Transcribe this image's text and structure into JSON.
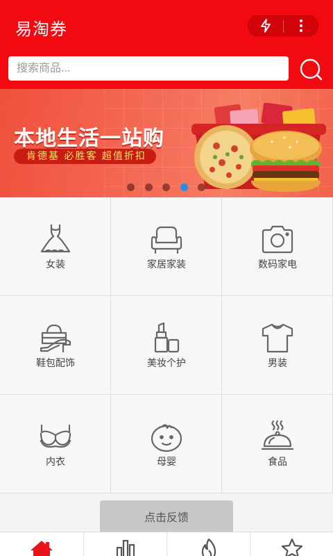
{
  "header": {
    "title": "易淘券",
    "background_color": "#f30a10",
    "capsule_icons": [
      "flash-icon",
      "more-vertical-icon"
    ]
  },
  "search": {
    "placeholder": "搜索商品...",
    "value": "",
    "icon": "search-icon"
  },
  "banner": {
    "title": "本地生活一站购",
    "tagline": "肯德基  必胜客  超值折扣",
    "slide_count": 5,
    "active_slide": 4,
    "indicator_active_color": "#2a8ce8"
  },
  "categories": [
    {
      "label": "女装",
      "icon": "dress-icon"
    },
    {
      "label": "家居家装",
      "icon": "sofa-icon"
    },
    {
      "label": "数码家电",
      "icon": "camera-icon"
    },
    {
      "label": "鞋包配饰",
      "icon": "shoe-bag-icon"
    },
    {
      "label": "美妆个护",
      "icon": "lipstick-icon"
    },
    {
      "label": "男装",
      "icon": "tshirt-icon"
    },
    {
      "label": "内衣",
      "icon": "bra-icon"
    },
    {
      "label": "母婴",
      "icon": "baby-icon"
    },
    {
      "label": "食品",
      "icon": "food-cloche-icon"
    }
  ],
  "feedback": {
    "label": "点击反馈"
  },
  "tabbar": {
    "active_color": "#e8141b",
    "inactive_color": "#555555",
    "tabs": [
      {
        "icon": "home-icon",
        "active": true
      },
      {
        "icon": "ranking-icon",
        "active": false
      },
      {
        "icon": "hot-icon",
        "active": false
      },
      {
        "icon": "star-icon",
        "active": false
      }
    ]
  }
}
